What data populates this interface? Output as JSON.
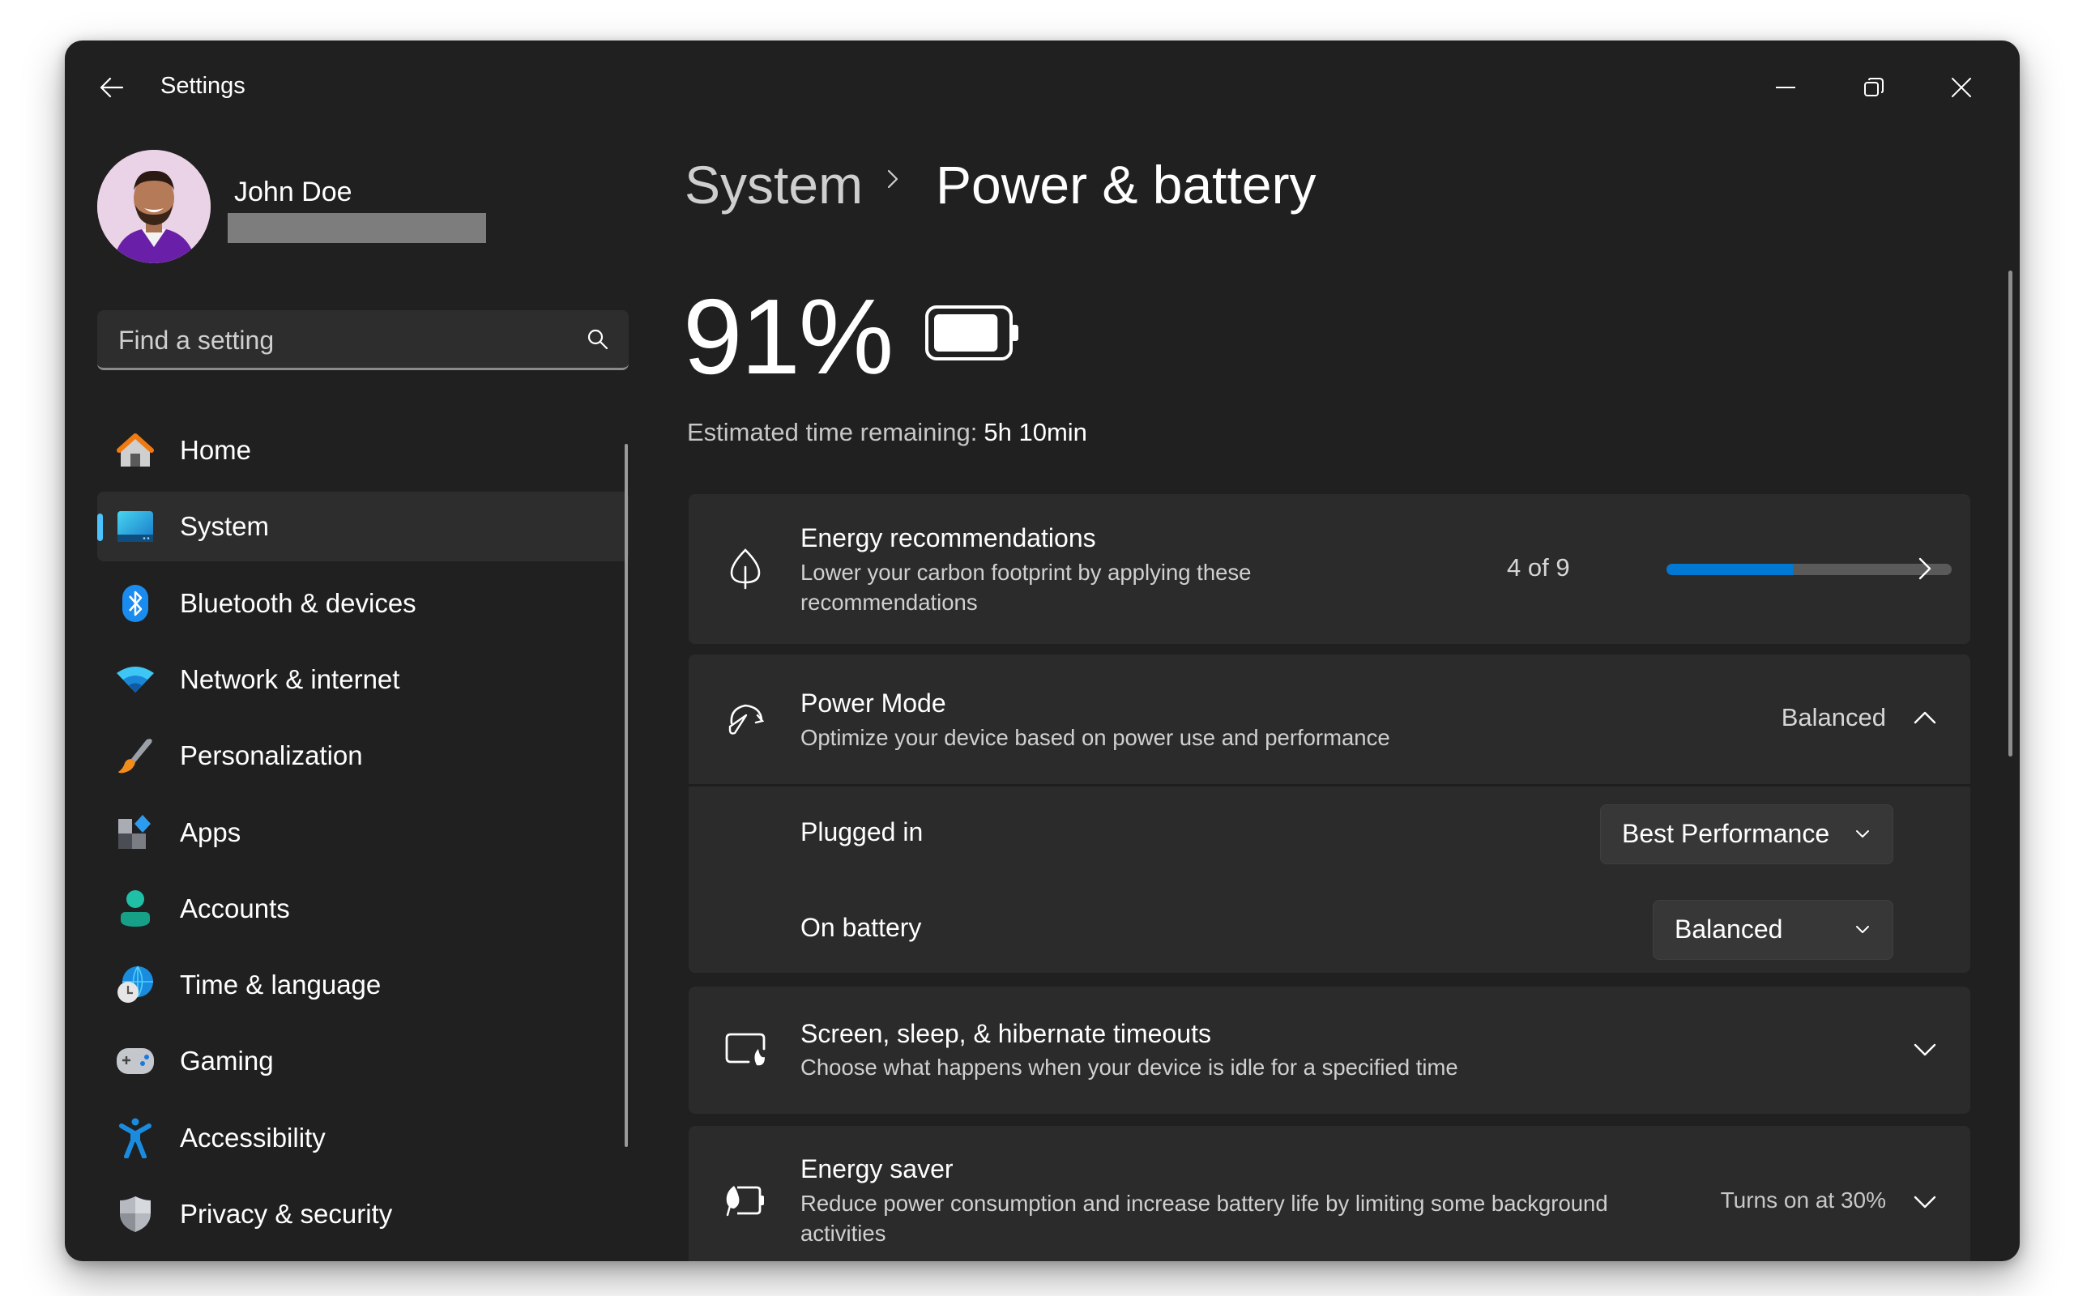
{
  "window": {
    "title": "Settings",
    "controls": {
      "minimize": "minimize-icon",
      "restore": "restore-icon",
      "close": "close-icon"
    }
  },
  "profile": {
    "name": "John Doe",
    "email_redacted": true
  },
  "search": {
    "placeholder": "Find a setting",
    "value": ""
  },
  "sidebar": {
    "items": [
      {
        "label": "Home",
        "icon": "home-icon",
        "selected": false
      },
      {
        "label": "System",
        "icon": "system-icon",
        "selected": true
      },
      {
        "label": "Bluetooth & devices",
        "icon": "bluetooth-icon",
        "selected": false
      },
      {
        "label": "Network & internet",
        "icon": "wifi-icon",
        "selected": false
      },
      {
        "label": "Personalization",
        "icon": "paintbrush-icon",
        "selected": false
      },
      {
        "label": "Apps",
        "icon": "apps-icon",
        "selected": false
      },
      {
        "label": "Accounts",
        "icon": "account-icon",
        "selected": false
      },
      {
        "label": "Time & language",
        "icon": "globe-clock-icon",
        "selected": false
      },
      {
        "label": "Gaming",
        "icon": "gamepad-icon",
        "selected": false
      },
      {
        "label": "Accessibility",
        "icon": "accessibility-icon",
        "selected": false
      },
      {
        "label": "Privacy & security",
        "icon": "shield-icon",
        "selected": false
      }
    ]
  },
  "breadcrumb": {
    "parent": "System",
    "separator_icon": "chevron-right-icon",
    "current": "Power & battery"
  },
  "battery": {
    "percent_label": "91%",
    "percent": 91,
    "estimate_label": "Estimated time remaining:",
    "estimate_value": "5h 10min"
  },
  "cards": {
    "energy_recommendations": {
      "title": "Energy recommendations",
      "description": "Lower your carbon footprint by applying these recommendations",
      "progress_label": "4 of 9",
      "progress_done": 4,
      "progress_total": 9,
      "accent": "#0078d4"
    },
    "power_mode": {
      "title": "Power Mode",
      "description": "Optimize your device based on power use and performance",
      "value": "Balanced",
      "expanded": true,
      "plugged_in_label": "Plugged in",
      "plugged_in_value": "Best Performance",
      "on_battery_label": "On battery",
      "on_battery_value": "Balanced"
    },
    "screen_sleep": {
      "title": "Screen, sleep, & hibernate timeouts",
      "description": "Choose what happens when your device is idle for a specified time"
    },
    "energy_saver": {
      "title": "Energy saver",
      "description": "Reduce power consumption and increase battery life by limiting some background activities",
      "value": "Turns on at 30%"
    }
  }
}
